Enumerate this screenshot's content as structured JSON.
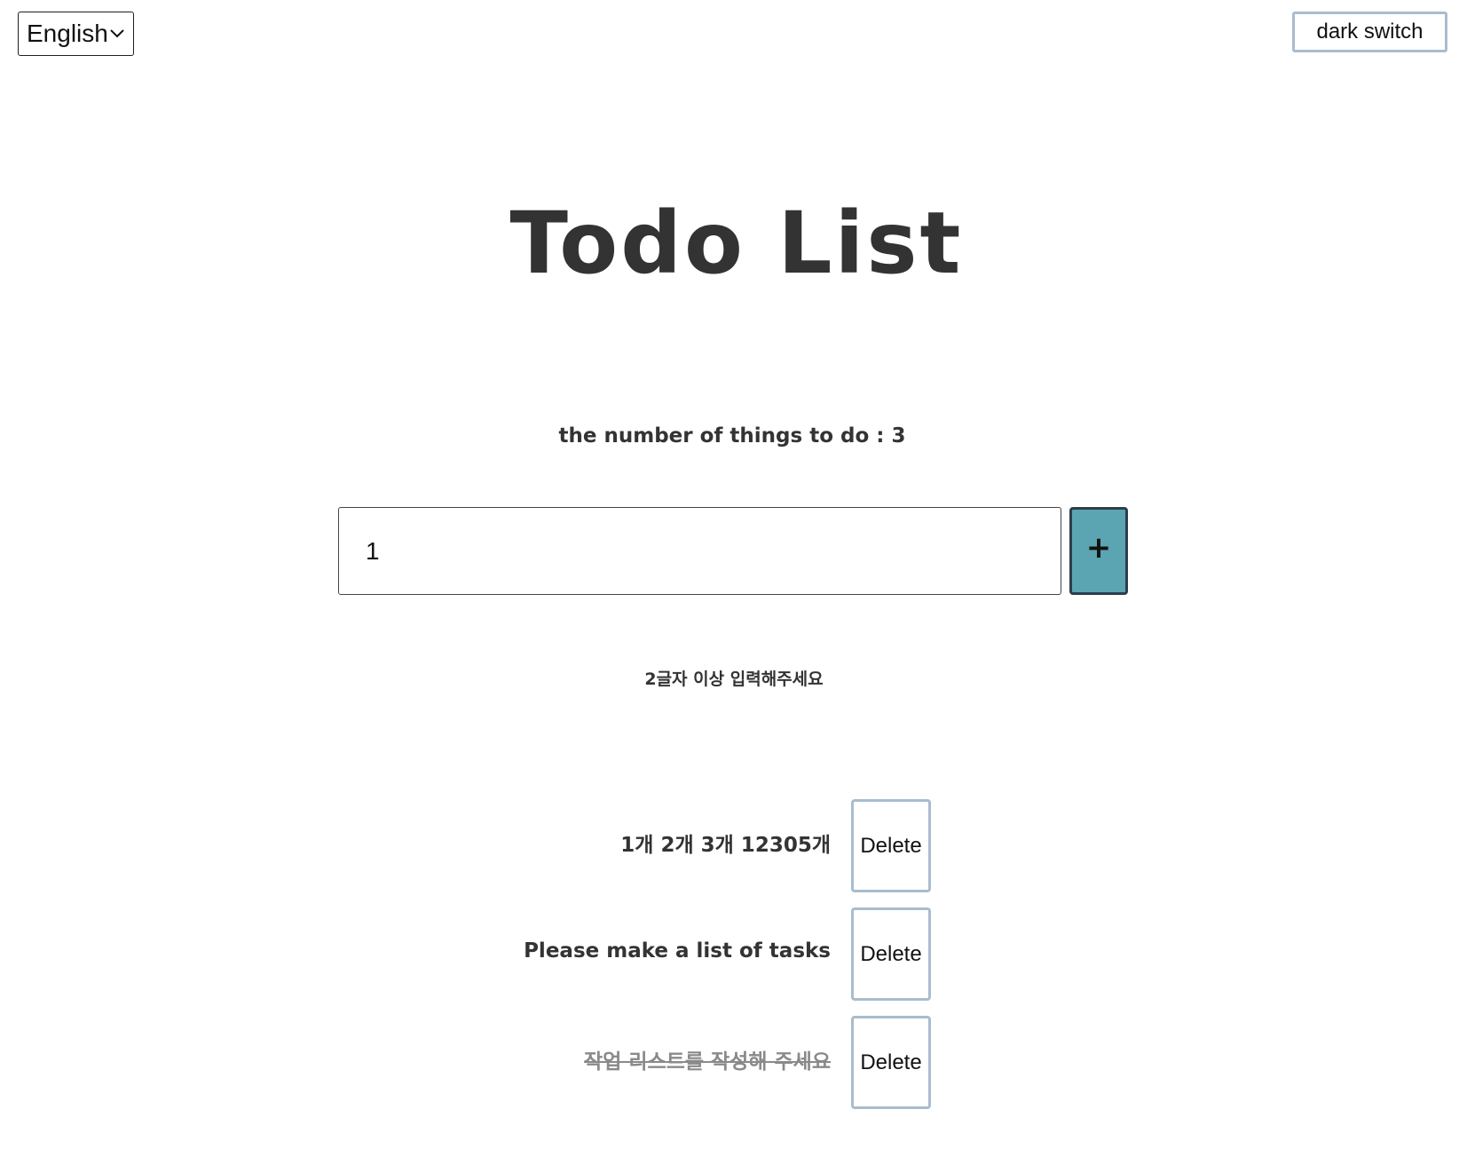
{
  "language_select": {
    "selected": "English",
    "icon": "chevron-down-icon"
  },
  "dark_switch": {
    "label": "dark switch"
  },
  "header": {
    "title": "Todo List"
  },
  "counter": {
    "text": "the number of things to do : 3"
  },
  "todo_input": {
    "value": "1"
  },
  "add_button": {
    "label": "+",
    "color": "#5aa5b1"
  },
  "validation": {
    "message": "2글자 이상 입력해주세요"
  },
  "todos": [
    {
      "text": "1개 2개 3개 12305개",
      "done": false,
      "delete_label": "Delete"
    },
    {
      "text": "Please make a list of tasks",
      "done": false,
      "delete_label": "Delete"
    },
    {
      "text": "작업 리스트를 작성해 주세요",
      "done": true,
      "delete_label": "Delete"
    }
  ]
}
